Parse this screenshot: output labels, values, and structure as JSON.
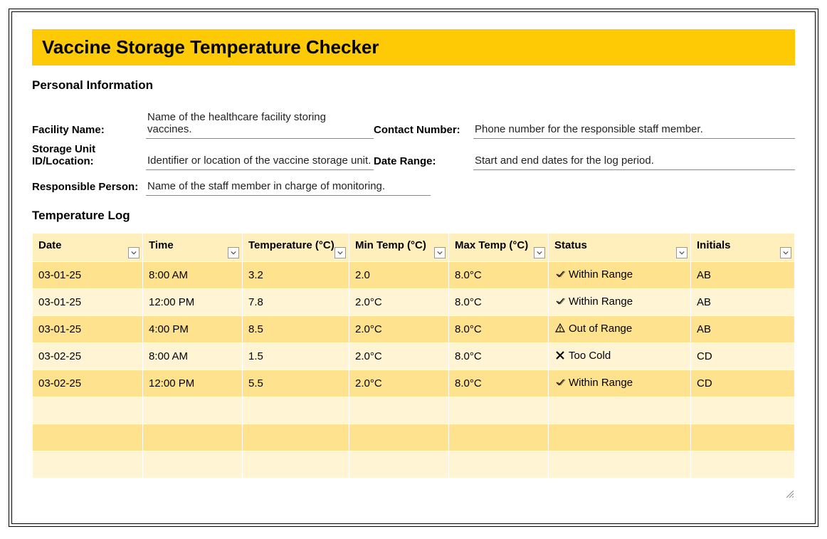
{
  "title": "Vaccine Storage Temperature Checker",
  "sections": {
    "personal": "Personal Information",
    "log": "Temperature Log"
  },
  "info": {
    "facility_label": "Facility Name:",
    "facility_value": "Name of the healthcare facility storing vaccines.",
    "contact_label": "Contact Number:",
    "contact_value": "Phone number for the responsible staff member.",
    "storage_label": "Storage Unit ID/Location:",
    "storage_value": "Identifier or location of the vaccine storage unit.",
    "daterange_label": "Date Range:",
    "daterange_value": "Start and end dates for the log period.",
    "responsible_label": "Responsible Person:",
    "responsible_value": "Name of the staff member in charge of monitoring."
  },
  "columns": {
    "date": "Date",
    "time": "Time",
    "temp": "Temperature (°C)",
    "min": "Min Temp (°C)",
    "max": "Max Temp (°C)",
    "status": "Status",
    "initials": "Initials"
  },
  "status_labels": {
    "within": "Within Range",
    "out": "Out of Range",
    "cold": "Too Cold"
  },
  "rows": [
    {
      "date": "03-01-25",
      "time": "8:00 AM",
      "temp": "3.2",
      "min": "2.0",
      "max": "8.0°C",
      "status": "within",
      "initials": "AB"
    },
    {
      "date": "03-01-25",
      "time": "12:00 PM",
      "temp": "7.8",
      "min": "2.0°C",
      "max": "8.0°C",
      "status": "within",
      "initials": "AB"
    },
    {
      "date": "03-01-25",
      "time": "4:00 PM",
      "temp": "8.5",
      "min": "2.0°C",
      "max": "8.0°C",
      "status": "out",
      "initials": "AB"
    },
    {
      "date": "03-02-25",
      "time": "8:00 AM",
      "temp": "1.5",
      "min": "2.0°C",
      "max": "8.0°C",
      "status": "cold",
      "initials": "CD"
    },
    {
      "date": "03-02-25",
      "time": "12:00 PM",
      "temp": "5.5",
      "min": "2.0°C",
      "max": "8.0°C",
      "status": "within",
      "initials": "CD"
    }
  ],
  "empty_rows": 3
}
